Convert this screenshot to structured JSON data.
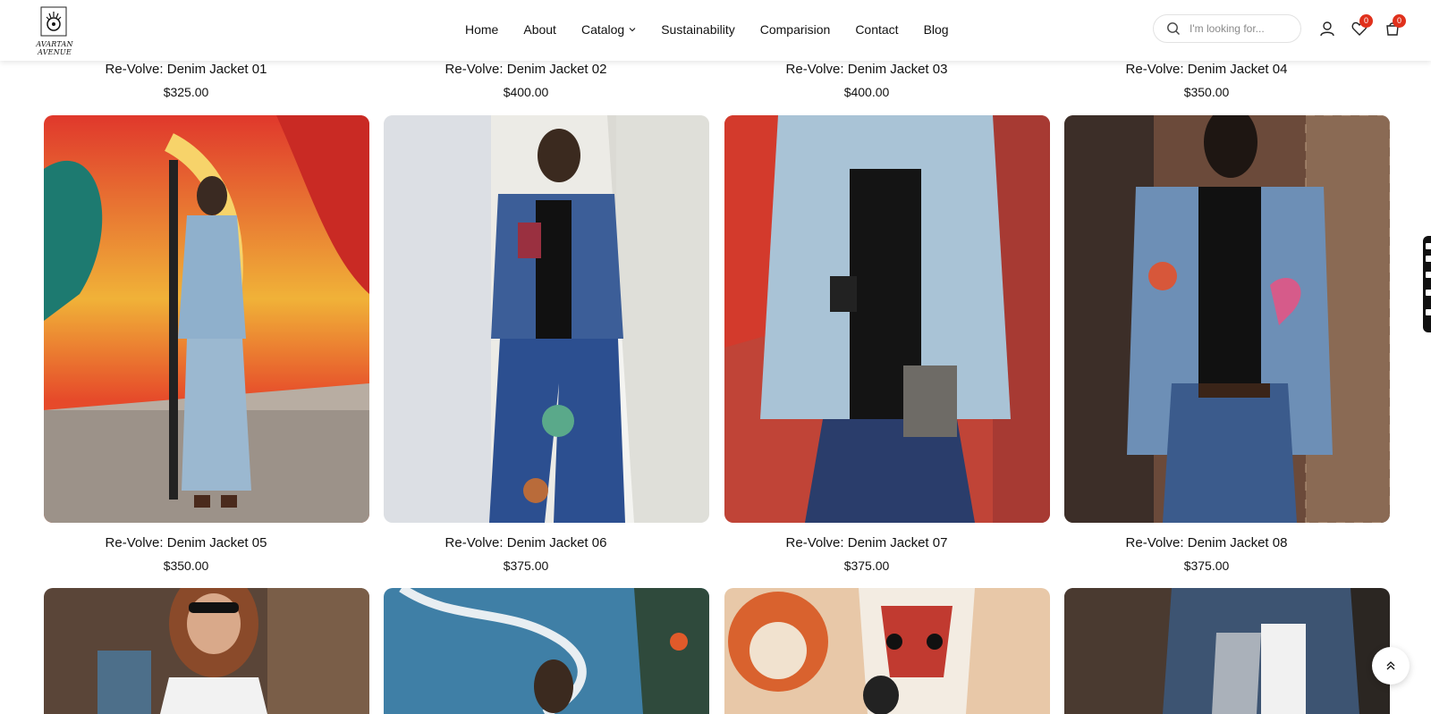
{
  "brand": {
    "name": "AVARTAN AVENUE",
    "logo_icon": "hamsa-logo-icon"
  },
  "nav": [
    {
      "label": "Home"
    },
    {
      "label": "About"
    },
    {
      "label": "Catalog",
      "icon": "chevron-down-icon"
    },
    {
      "label": "Sustainability"
    },
    {
      "label": "Comparision"
    },
    {
      "label": "Contact"
    },
    {
      "label": "Blog"
    }
  ],
  "search": {
    "placeholder": "I'm looking for...",
    "value": "",
    "icon": "search-icon"
  },
  "header_icons": {
    "account": "user-icon",
    "wishlist": {
      "icon": "heart-icon",
      "count": "0"
    },
    "cart": {
      "icon": "cart-icon",
      "count": "0"
    }
  },
  "products": [
    {
      "title": "Re-Volve: Denim Jacket 01",
      "price": "$325.00"
    },
    {
      "title": "Re-Volve: Denim Jacket 02",
      "price": "$400.00"
    },
    {
      "title": "Re-Volve: Denim Jacket 03",
      "price": "$400.00"
    },
    {
      "title": "Re-Volve: Denim Jacket 04",
      "price": "$350.00"
    },
    {
      "title": "Re-Volve: Denim Jacket 05",
      "price": "$350.00"
    },
    {
      "title": "Re-Volve: Denim Jacket 06",
      "price": "$375.00"
    },
    {
      "title": "Re-Volve: Denim Jacket 07",
      "price": "$375.00"
    },
    {
      "title": "Re-Volve: Denim Jacket 08",
      "price": "$375.00"
    }
  ],
  "floating": {
    "back_to_top_icon": "chevrons-up-icon",
    "side_tab": "floating-social-tab"
  },
  "colors": {
    "badge": "#e0311c",
    "text": "#111111"
  }
}
